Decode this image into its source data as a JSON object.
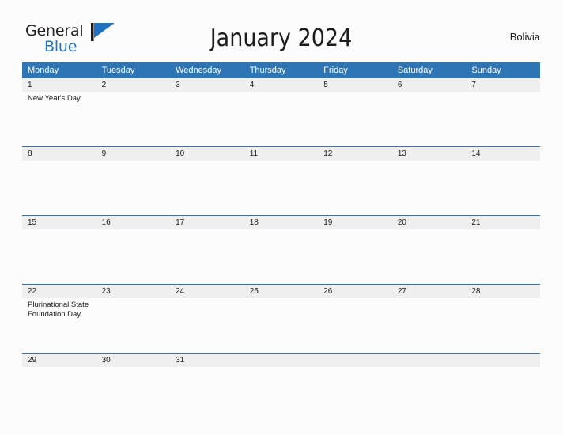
{
  "brand": {
    "name_part1": "General",
    "name_part2": "Blue",
    "mark": "flag-triangle-icon"
  },
  "header": {
    "title": "January 2024",
    "country": "Bolivia"
  },
  "calendar": {
    "weekday_headers": [
      "Monday",
      "Tuesday",
      "Wednesday",
      "Thursday",
      "Friday",
      "Saturday",
      "Sunday"
    ],
    "colors": {
      "header_blue": "#2e75b6",
      "date_band_gray": "#efefef",
      "page_background": "#fcfcfd",
      "brand_blue": "#1f71c1",
      "text": "#1a1a1a"
    },
    "weeks": [
      {
        "days": [
          {
            "num": "1",
            "events": [
              "New Year's Day"
            ]
          },
          {
            "num": "2",
            "events": []
          },
          {
            "num": "3",
            "events": []
          },
          {
            "num": "4",
            "events": []
          },
          {
            "num": "5",
            "events": []
          },
          {
            "num": "6",
            "events": []
          },
          {
            "num": "7",
            "events": []
          }
        ]
      },
      {
        "days": [
          {
            "num": "8",
            "events": []
          },
          {
            "num": "9",
            "events": []
          },
          {
            "num": "10",
            "events": []
          },
          {
            "num": "11",
            "events": []
          },
          {
            "num": "12",
            "events": []
          },
          {
            "num": "13",
            "events": []
          },
          {
            "num": "14",
            "events": []
          }
        ]
      },
      {
        "days": [
          {
            "num": "15",
            "events": []
          },
          {
            "num": "16",
            "events": []
          },
          {
            "num": "17",
            "events": []
          },
          {
            "num": "18",
            "events": []
          },
          {
            "num": "19",
            "events": []
          },
          {
            "num": "20",
            "events": []
          },
          {
            "num": "21",
            "events": []
          }
        ]
      },
      {
        "days": [
          {
            "num": "22",
            "events": [
              "Plurinational State Foundation Day"
            ]
          },
          {
            "num": "23",
            "events": []
          },
          {
            "num": "24",
            "events": []
          },
          {
            "num": "25",
            "events": []
          },
          {
            "num": "26",
            "events": []
          },
          {
            "num": "27",
            "events": []
          },
          {
            "num": "28",
            "events": []
          }
        ]
      },
      {
        "days": [
          {
            "num": "29",
            "events": []
          },
          {
            "num": "30",
            "events": []
          },
          {
            "num": "31",
            "events": []
          },
          {
            "num": "",
            "events": []
          },
          {
            "num": "",
            "events": []
          },
          {
            "num": "",
            "events": []
          },
          {
            "num": "",
            "events": []
          }
        ]
      }
    ]
  }
}
